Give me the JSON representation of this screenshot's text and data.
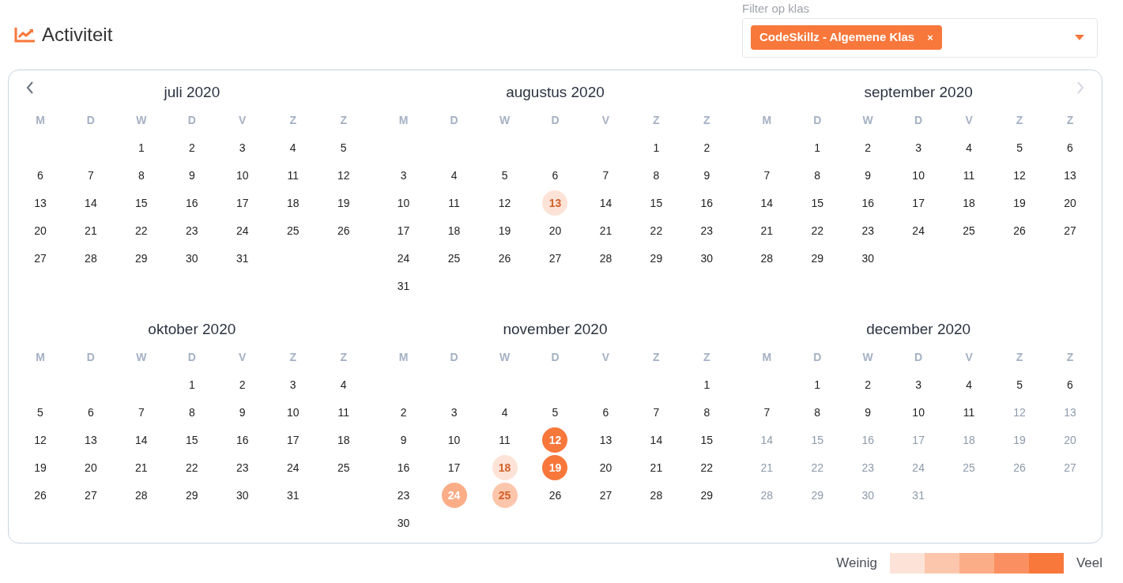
{
  "header": {
    "title": "Activiteit"
  },
  "filter": {
    "label": "Filter op klas",
    "tags": [
      {
        "label": "CodeSkillz - Algemene Klas",
        "remove": "×"
      }
    ]
  },
  "calendar": {
    "prev_disabled": false,
    "next_disabled": true,
    "months": [
      {
        "title": "juli 2020",
        "weekdays": [
          "M",
          "D",
          "W",
          "D",
          "V",
          "Z",
          "Z"
        ],
        "weeks": [
          {
            "kind": "lead",
            "days": [
              {
                "d": "1",
                "disabled": false
              },
              {
                "d": "2",
                "disabled": false
              },
              {
                "d": "3",
                "disabled": false
              },
              {
                "d": "4",
                "disabled": false
              },
              {
                "d": "5",
                "disabled": false
              }
            ]
          },
          {
            "kind": "rest",
            "days": [
              {
                "d": "6",
                "disabled": false
              },
              {
                "d": "7",
                "disabled": false
              },
              {
                "d": "8",
                "disabled": false
              },
              {
                "d": "9",
                "disabled": false
              },
              {
                "d": "10",
                "disabled": false
              },
              {
                "d": "11",
                "disabled": false
              },
              {
                "d": "12",
                "disabled": false
              }
            ]
          },
          {
            "kind": "rest",
            "days": [
              {
                "d": "13",
                "disabled": false
              },
              {
                "d": "14",
                "disabled": false
              },
              {
                "d": "15",
                "disabled": false
              },
              {
                "d": "16",
                "disabled": false
              },
              {
                "d": "17",
                "disabled": false
              },
              {
                "d": "18",
                "disabled": false
              },
              {
                "d": "19",
                "disabled": false
              }
            ]
          },
          {
            "kind": "rest",
            "days": [
              {
                "d": "20",
                "disabled": false
              },
              {
                "d": "21",
                "disabled": false
              },
              {
                "d": "22",
                "disabled": false
              },
              {
                "d": "23",
                "disabled": false
              },
              {
                "d": "24",
                "disabled": false
              },
              {
                "d": "25",
                "disabled": false
              },
              {
                "d": "26",
                "disabled": false
              }
            ]
          },
          {
            "kind": "rest",
            "days": [
              {
                "d": "27",
                "disabled": false
              },
              {
                "d": "28",
                "disabled": false
              },
              {
                "d": "29",
                "disabled": false
              },
              {
                "d": "30",
                "disabled": false
              },
              {
                "d": "31",
                "disabled": false
              }
            ]
          }
        ]
      },
      {
        "title": "augustus 2020",
        "weekdays": [
          "M",
          "D",
          "W",
          "D",
          "V",
          "Z",
          "Z"
        ],
        "weeks": [
          {
            "kind": "lead",
            "days": [
              {
                "d": "1",
                "disabled": false
              },
              {
                "d": "2",
                "disabled": false
              }
            ]
          },
          {
            "kind": "rest",
            "days": [
              {
                "d": "3",
                "disabled": false
              },
              {
                "d": "4",
                "disabled": false
              },
              {
                "d": "5",
                "disabled": false
              },
              {
                "d": "6",
                "disabled": false
              },
              {
                "d": "7",
                "disabled": false
              },
              {
                "d": "8",
                "disabled": false
              },
              {
                "d": "9",
                "disabled": false
              }
            ]
          },
          {
            "kind": "rest",
            "days": [
              {
                "d": "10",
                "disabled": false
              },
              {
                "d": "11",
                "disabled": false
              },
              {
                "d": "12",
                "disabled": false
              },
              {
                "d": "13",
                "disabled": false,
                "color": "#fde3d7"
              },
              {
                "d": "14",
                "disabled": false
              },
              {
                "d": "15",
                "disabled": false
              },
              {
                "d": "16",
                "disabled": false
              }
            ]
          },
          {
            "kind": "rest",
            "days": [
              {
                "d": "17",
                "disabled": false
              },
              {
                "d": "18",
                "disabled": false
              },
              {
                "d": "19",
                "disabled": false
              },
              {
                "d": "20",
                "disabled": false
              },
              {
                "d": "21",
                "disabled": false
              },
              {
                "d": "22",
                "disabled": false
              },
              {
                "d": "23",
                "disabled": false
              }
            ]
          },
          {
            "kind": "rest",
            "days": [
              {
                "d": "24",
                "disabled": false
              },
              {
                "d": "25",
                "disabled": false
              },
              {
                "d": "26",
                "disabled": false
              },
              {
                "d": "27",
                "disabled": false
              },
              {
                "d": "28",
                "disabled": false
              },
              {
                "d": "29",
                "disabled": false
              },
              {
                "d": "30",
                "disabled": false
              }
            ]
          },
          {
            "kind": "rest",
            "days": [
              {
                "d": "31",
                "disabled": false
              }
            ]
          }
        ]
      },
      {
        "title": "september 2020",
        "weekdays": [
          "M",
          "D",
          "W",
          "D",
          "V",
          "Z",
          "Z"
        ],
        "weeks": [
          {
            "kind": "lead",
            "days": [
              {
                "d": "1",
                "disabled": false
              },
              {
                "d": "2",
                "disabled": false
              },
              {
                "d": "3",
                "disabled": false
              },
              {
                "d": "4",
                "disabled": false
              },
              {
                "d": "5",
                "disabled": false
              },
              {
                "d": "6",
                "disabled": false
              }
            ]
          },
          {
            "kind": "rest",
            "days": [
              {
                "d": "7",
                "disabled": false
              },
              {
                "d": "8",
                "disabled": false
              },
              {
                "d": "9",
                "disabled": false
              },
              {
                "d": "10",
                "disabled": false
              },
              {
                "d": "11",
                "disabled": false
              },
              {
                "d": "12",
                "disabled": false
              },
              {
                "d": "13",
                "disabled": false
              }
            ]
          },
          {
            "kind": "rest",
            "days": [
              {
                "d": "14",
                "disabled": false
              },
              {
                "d": "15",
                "disabled": false
              },
              {
                "d": "16",
                "disabled": false
              },
              {
                "d": "17",
                "disabled": false
              },
              {
                "d": "18",
                "disabled": false
              },
              {
                "d": "19",
                "disabled": false
              },
              {
                "d": "20",
                "disabled": false
              }
            ]
          },
          {
            "kind": "rest",
            "days": [
              {
                "d": "21",
                "disabled": false
              },
              {
                "d": "22",
                "disabled": false
              },
              {
                "d": "23",
                "disabled": false
              },
              {
                "d": "24",
                "disabled": false
              },
              {
                "d": "25",
                "disabled": false
              },
              {
                "d": "26",
                "disabled": false
              },
              {
                "d": "27",
                "disabled": false
              }
            ]
          },
          {
            "kind": "rest",
            "days": [
              {
                "d": "28",
                "disabled": false
              },
              {
                "d": "29",
                "disabled": false
              },
              {
                "d": "30",
                "disabled": false
              }
            ]
          }
        ]
      },
      {
        "title": "oktober 2020",
        "weekdays": [
          "M",
          "D",
          "W",
          "D",
          "V",
          "Z",
          "Z"
        ],
        "weeks": [
          {
            "kind": "lead",
            "days": [
              {
                "d": "1",
                "disabled": false
              },
              {
                "d": "2",
                "disabled": false
              },
              {
                "d": "3",
                "disabled": false
              },
              {
                "d": "4",
                "disabled": false
              }
            ]
          },
          {
            "kind": "rest",
            "days": [
              {
                "d": "5",
                "disabled": false
              },
              {
                "d": "6",
                "disabled": false
              },
              {
                "d": "7",
                "disabled": false
              },
              {
                "d": "8",
                "disabled": false
              },
              {
                "d": "9",
                "disabled": false
              },
              {
                "d": "10",
                "disabled": false
              },
              {
                "d": "11",
                "disabled": false
              }
            ]
          },
          {
            "kind": "rest",
            "days": [
              {
                "d": "12",
                "disabled": false
              },
              {
                "d": "13",
                "disabled": false
              },
              {
                "d": "14",
                "disabled": false
              },
              {
                "d": "15",
                "disabled": false
              },
              {
                "d": "16",
                "disabled": false
              },
              {
                "d": "17",
                "disabled": false
              },
              {
                "d": "18",
                "disabled": false
              }
            ]
          },
          {
            "kind": "rest",
            "days": [
              {
                "d": "19",
                "disabled": false
              },
              {
                "d": "20",
                "disabled": false
              },
              {
                "d": "21",
                "disabled": false
              },
              {
                "d": "22",
                "disabled": false
              },
              {
                "d": "23",
                "disabled": false
              },
              {
                "d": "24",
                "disabled": false
              },
              {
                "d": "25",
                "disabled": false
              }
            ]
          },
          {
            "kind": "rest",
            "days": [
              {
                "d": "26",
                "disabled": false
              },
              {
                "d": "27",
                "disabled": false
              },
              {
                "d": "28",
                "disabled": false
              },
              {
                "d": "29",
                "disabled": false
              },
              {
                "d": "30",
                "disabled": false
              },
              {
                "d": "31",
                "disabled": false
              }
            ]
          }
        ]
      },
      {
        "title": "november 2020",
        "weekdays": [
          "M",
          "D",
          "W",
          "D",
          "V",
          "Z",
          "Z"
        ],
        "weeks": [
          {
            "kind": "lead",
            "days": [
              {
                "d": "1",
                "disabled": false
              }
            ]
          },
          {
            "kind": "rest",
            "days": [
              {
                "d": "2",
                "disabled": false
              },
              {
                "d": "3",
                "disabled": false
              },
              {
                "d": "4",
                "disabled": false
              },
              {
                "d": "5",
                "disabled": false
              },
              {
                "d": "6",
                "disabled": false
              },
              {
                "d": "7",
                "disabled": false
              },
              {
                "d": "8",
                "disabled": false
              }
            ]
          },
          {
            "kind": "rest",
            "days": [
              {
                "d": "9",
                "disabled": false
              },
              {
                "d": "10",
                "disabled": false
              },
              {
                "d": "11",
                "disabled": false
              },
              {
                "d": "12",
                "disabled": false,
                "color": "#f8773b"
              },
              {
                "d": "13",
                "disabled": false
              },
              {
                "d": "14",
                "disabled": false
              },
              {
                "d": "15",
                "disabled": false
              }
            ]
          },
          {
            "kind": "rest",
            "days": [
              {
                "d": "16",
                "disabled": false
              },
              {
                "d": "17",
                "disabled": false
              },
              {
                "d": "18",
                "disabled": false,
                "color": "#fde3d7"
              },
              {
                "d": "19",
                "disabled": false,
                "color": "#f8773b"
              },
              {
                "d": "20",
                "disabled": false
              },
              {
                "d": "21",
                "disabled": false
              },
              {
                "d": "22",
                "disabled": false
              }
            ]
          },
          {
            "kind": "rest",
            "days": [
              {
                "d": "23",
                "disabled": false
              },
              {
                "d": "24",
                "disabled": false,
                "color": "#fbad87"
              },
              {
                "d": "25",
                "disabled": false,
                "color": "#fcc6ac"
              },
              {
                "d": "26",
                "disabled": false
              },
              {
                "d": "27",
                "disabled": false
              },
              {
                "d": "28",
                "disabled": false
              },
              {
                "d": "29",
                "disabled": false
              }
            ]
          },
          {
            "kind": "rest",
            "days": [
              {
                "d": "30",
                "disabled": false
              }
            ]
          }
        ]
      },
      {
        "title": "december 2020",
        "weekdays": [
          "M",
          "D",
          "W",
          "D",
          "V",
          "Z",
          "Z"
        ],
        "weeks": [
          {
            "kind": "lead",
            "days": [
              {
                "d": "1",
                "disabled": false
              },
              {
                "d": "2",
                "disabled": false
              },
              {
                "d": "3",
                "disabled": false
              },
              {
                "d": "4",
                "disabled": false
              },
              {
                "d": "5",
                "disabled": false
              },
              {
                "d": "6",
                "disabled": false
              }
            ]
          },
          {
            "kind": "rest",
            "days": [
              {
                "d": "7",
                "disabled": false
              },
              {
                "d": "8",
                "disabled": false
              },
              {
                "d": "9",
                "disabled": false
              },
              {
                "d": "10",
                "disabled": false
              },
              {
                "d": "11",
                "disabled": false
              },
              {
                "d": "12",
                "disabled": true
              },
              {
                "d": "13",
                "disabled": true
              }
            ]
          },
          {
            "kind": "rest",
            "days": [
              {
                "d": "14",
                "disabled": true
              },
              {
                "d": "15",
                "disabled": true
              },
              {
                "d": "16",
                "disabled": true
              },
              {
                "d": "17",
                "disabled": true
              },
              {
                "d": "18",
                "disabled": true
              },
              {
                "d": "19",
                "disabled": true
              },
              {
                "d": "20",
                "disabled": true
              }
            ]
          },
          {
            "kind": "rest",
            "days": [
              {
                "d": "21",
                "disabled": true
              },
              {
                "d": "22",
                "disabled": true
              },
              {
                "d": "23",
                "disabled": true
              },
              {
                "d": "24",
                "disabled": true
              },
              {
                "d": "25",
                "disabled": true
              },
              {
                "d": "26",
                "disabled": true
              },
              {
                "d": "27",
                "disabled": true
              }
            ]
          },
          {
            "kind": "rest",
            "days": [
              {
                "d": "28",
                "disabled": true
              },
              {
                "d": "29",
                "disabled": true
              },
              {
                "d": "30",
                "disabled": true
              },
              {
                "d": "31",
                "disabled": true
              }
            ]
          }
        ]
      }
    ]
  },
  "legend": {
    "low": "Weinig",
    "high": "Veel",
    "swatches": [
      {
        "color": "#fde3d7"
      },
      {
        "color": "#fcc6ac"
      },
      {
        "color": "#fbad87"
      },
      {
        "color": "#fa9061"
      },
      {
        "color": "#f8773b"
      }
    ]
  }
}
